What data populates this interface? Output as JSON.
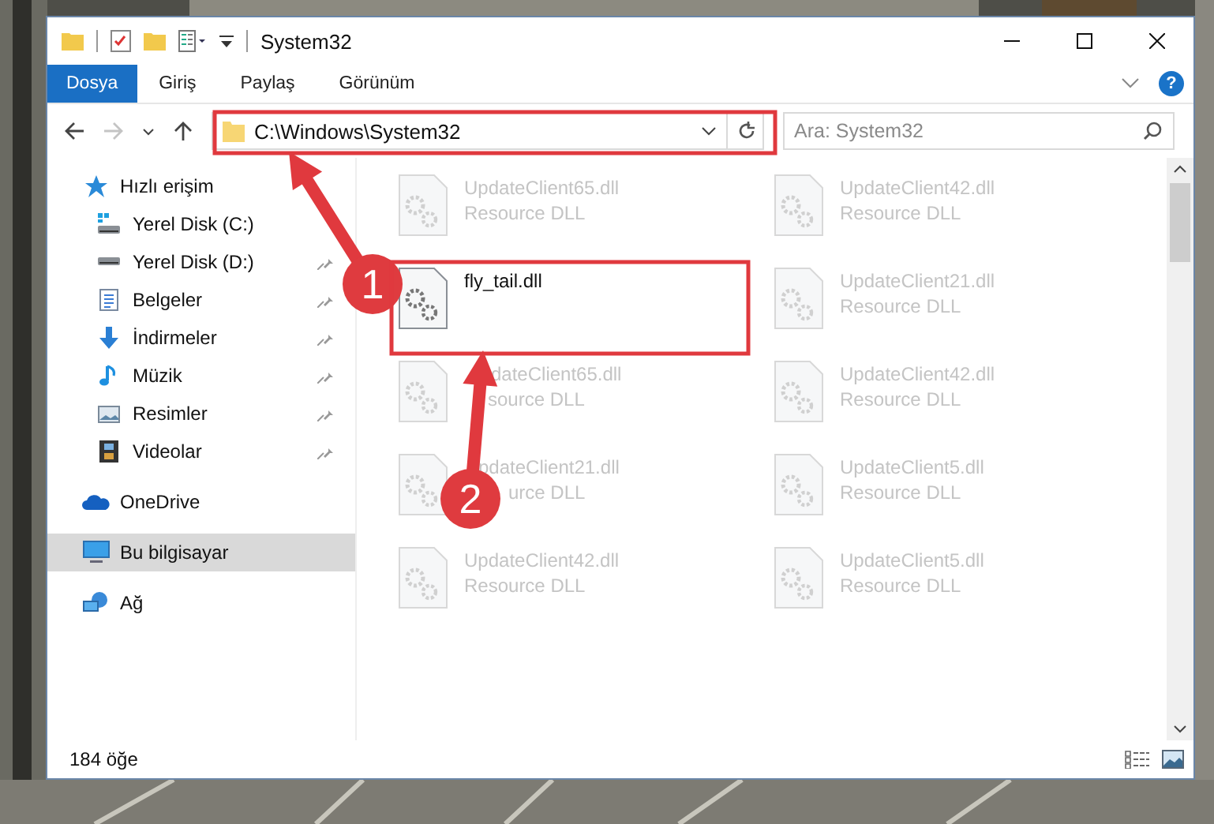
{
  "window": {
    "title": "System32"
  },
  "ribbon": {
    "tabs": [
      {
        "label": "Dosya",
        "selected": true
      },
      {
        "label": "Giriş",
        "selected": false
      },
      {
        "label": "Paylaş",
        "selected": false
      },
      {
        "label": "Görünüm",
        "selected": false
      }
    ],
    "help": "?"
  },
  "navigation": [
    {
      "kind": "back",
      "disabled": false
    },
    {
      "kind": "forward",
      "disabled": true
    },
    {
      "kind": "recent",
      "disabled": false
    },
    {
      "kind": "up",
      "disabled": false
    }
  ],
  "address": {
    "path": "C:\\Windows\\System32"
  },
  "search": {
    "placeholder": "Ara: System32"
  },
  "sidebar": {
    "items": [
      {
        "label": "Hızlı erişim",
        "kind": "quick",
        "pinned": false,
        "selected": false,
        "children": [
          {
            "label": "Yerel Disk (C:)",
            "kind": "drive-c",
            "pinned": false,
            "selected": false
          },
          {
            "label": "Yerel Disk (D:)",
            "kind": "drive",
            "pinned": true,
            "selected": false
          },
          {
            "label": "Belgeler",
            "kind": "documents",
            "pinned": true,
            "selected": false
          },
          {
            "label": "İndirmeler",
            "kind": "downloads",
            "pinned": true,
            "selected": false
          },
          {
            "label": "Müzik",
            "kind": "music",
            "pinned": true,
            "selected": false
          },
          {
            "label": "Resimler",
            "kind": "pictures",
            "pinned": true,
            "selected": false
          },
          {
            "label": "Videolar",
            "kind": "videos",
            "pinned": true,
            "selected": false
          }
        ]
      },
      {
        "label": "OneDrive",
        "kind": "cloud",
        "pinned": false,
        "selected": false
      },
      {
        "label": "Bu bilgisayar",
        "kind": "computer",
        "pinned": false,
        "selected": true
      },
      {
        "label": "Ağ",
        "kind": "network",
        "pinned": false,
        "selected": false
      }
    ]
  },
  "files": [
    {
      "name": "UpdateClient65.dll",
      "type": "Resource DLL",
      "dimmed": true
    },
    {
      "name": "UpdateClient42.dll",
      "type": "Resource DLL",
      "dimmed": true
    },
    {
      "name": "fly_tail.dll",
      "dimmed": false
    },
    {
      "name": "UpdateClient21.dll",
      "type": "Resource DLL",
      "dimmed": true
    },
    {
      "name": "dateClient65.dll",
      "type": "source DLL",
      "dimmed": true
    },
    {
      "name": "UpdateClient42.dll",
      "type": "Resource DLL",
      "dimmed": true
    },
    {
      "name": "pdateClient21.dll",
      "type": "urce DLL",
      "dimmed": true
    },
    {
      "name": "UpdateClient5.dll",
      "type": "Resource DLL",
      "dimmed": true
    },
    {
      "name": "UpdateClient42.dll",
      "type": "Resource DLL",
      "dimmed": true
    },
    {
      "name": "UpdateClient5.dll",
      "type": "Resource DLL",
      "dimmed": true
    }
  ],
  "status_bar": {
    "count": "184 öğe"
  },
  "annotations": [
    {
      "number": "1"
    },
    {
      "number": "2"
    }
  ]
}
